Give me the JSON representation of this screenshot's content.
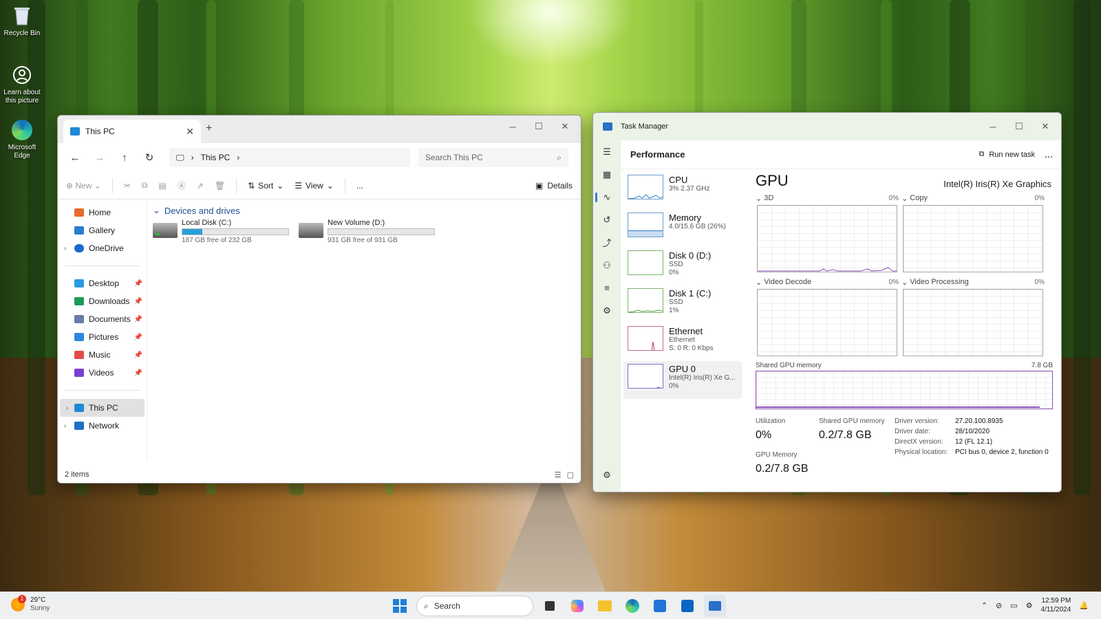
{
  "desktop": {
    "icons": [
      {
        "label": "Recycle Bin",
        "icon": "recycle-bin-icon"
      },
      {
        "label": "Learn about this picture",
        "icon": "camera-icon"
      },
      {
        "label": "Microsoft Edge",
        "icon": "edge-icon"
      }
    ]
  },
  "explorer": {
    "tab_title": "This PC",
    "breadcrumb": "This PC",
    "search_placeholder": "Search This PC",
    "commands": {
      "new": "New",
      "sort": "Sort",
      "view": "View",
      "more": "...",
      "details": "Details"
    },
    "sidebar": [
      {
        "label": "Home",
        "color": "#e66a2c"
      },
      {
        "label": "Gallery",
        "color": "#2b7bd3"
      },
      {
        "label": "OneDrive",
        "color": "#1769d1"
      },
      {
        "label": "Desktop",
        "color": "#2a9be0"
      },
      {
        "label": "Downloads",
        "color": "#1e9a55"
      },
      {
        "label": "Documents",
        "color": "#6a7ca8"
      },
      {
        "label": "Pictures",
        "color": "#2f86e0"
      },
      {
        "label": "Music",
        "color": "#e34b4b"
      },
      {
        "label": "Videos",
        "color": "#7a3fd1"
      },
      {
        "label": "This PC",
        "color": "#1c8ad6"
      },
      {
        "label": "Network",
        "color": "#2070c8"
      }
    ],
    "group": "Devices and drives",
    "drives": [
      {
        "name": "Local Disk (C:)",
        "free": "187 GB free of 232 GB",
        "used_fraction": 0.19
      },
      {
        "name": "New Volume (D:)",
        "free": "931 GB free of 931 GB",
        "used_fraction": 0.0
      }
    ],
    "status": "2 items"
  },
  "taskmgr": {
    "title": "Task Manager",
    "header": "Performance",
    "run_task": "Run new task",
    "more": "...",
    "devices": [
      {
        "name": "CPU",
        "sub1": "3% 2.37 GHz",
        "sub2": ""
      },
      {
        "name": "Memory",
        "sub1": "4.0/15.6 GB (26%)",
        "sub2": ""
      },
      {
        "name": "Disk 0 (D:)",
        "sub1": "SSD",
        "sub2": "0%"
      },
      {
        "name": "Disk 1 (C:)",
        "sub1": "SSD",
        "sub2": "1%"
      },
      {
        "name": "Ethernet",
        "sub1": "Ethernet",
        "sub2": "S: 0 R: 0 Kbps"
      },
      {
        "name": "GPU 0",
        "sub1": "Intel(R) Iris(R) Xe G...",
        "sub2": "0%"
      }
    ],
    "gpu": {
      "title": "GPU",
      "model": "Intel(R) Iris(R) Xe Graphics",
      "engines": [
        {
          "label": "3D",
          "pct": "0%"
        },
        {
          "label": "Copy",
          "pct": "0%"
        },
        {
          "label": "Video Decode",
          "pct": "0%"
        },
        {
          "label": "Video Processing",
          "pct": "0%"
        }
      ],
      "shared_label": "Shared GPU memory",
      "shared_max": "7.8 GB",
      "utilization_label": "Utilization",
      "utilization": "0%",
      "shared_mem_label": "Shared GPU memory",
      "shared_mem": "0.2/7.8 GB",
      "gpu_mem_label": "GPU Memory",
      "gpu_mem": "0.2/7.8 GB",
      "props": [
        {
          "k": "Driver version:",
          "v": "27.20.100.8935"
        },
        {
          "k": "Driver date:",
          "v": "28/10/2020"
        },
        {
          "k": "DirectX version:",
          "v": "12 (FL 12.1)"
        },
        {
          "k": "Physical location:",
          "v": "PCI bus 0, device 2, function 0"
        }
      ]
    }
  },
  "taskbar": {
    "weather_temp": "29°C",
    "weather_desc": "Sunny",
    "weather_badge": "1",
    "search_label": "Search",
    "time": "12:59 PM",
    "date": "4/11/2024"
  }
}
